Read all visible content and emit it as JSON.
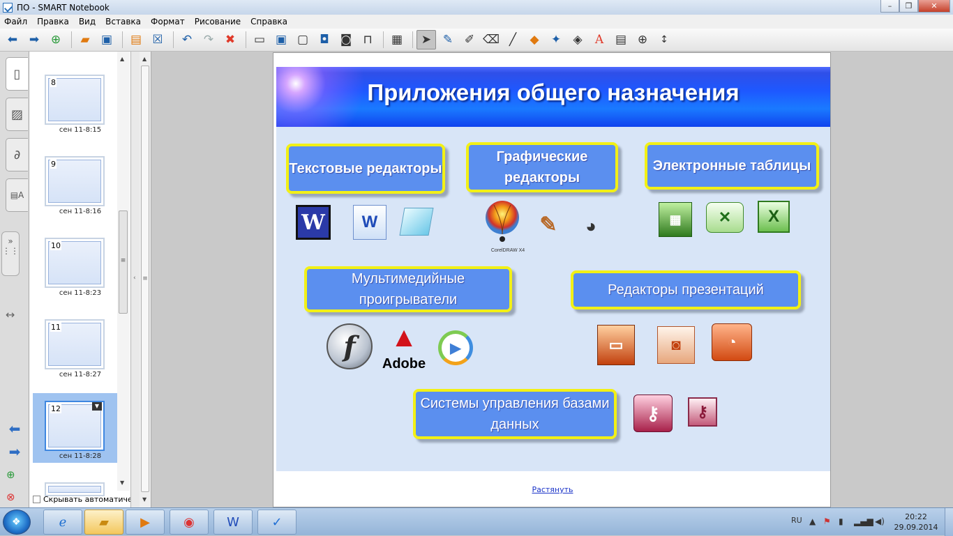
{
  "window": {
    "title": "ПО - SMART Notebook"
  },
  "menu": [
    "Файл",
    "Правка",
    "Вид",
    "Вставка",
    "Формат",
    "Рисование",
    "Справка"
  ],
  "toolbar": {
    "icons": [
      "back-arrow-icon",
      "forward-arrow-icon",
      "add-page-icon",
      "open-folder-icon",
      "save-icon",
      "paste-icon",
      "delete-page-icon",
      "undo-icon",
      "redo-icon",
      "delete-icon",
      "screen-shade-icon",
      "display-icon",
      "screen-capture-icon",
      "monitor-icon",
      "camera-icon",
      "toolbox-icon",
      "table-icon",
      "select-cursor-icon",
      "pen-icon",
      "creative-pen-icon",
      "eraser-icon",
      "line-icon",
      "shapes-icon",
      "magic-pen-icon",
      "fill-icon",
      "text-icon",
      "properties-icon",
      "measurement-icon",
      "move-toolbar-icon"
    ]
  },
  "sorter": {
    "pages": [
      {
        "num": "8",
        "time": "сен 11-8:15"
      },
      {
        "num": "9",
        "time": "сен 11-8:16"
      },
      {
        "num": "10",
        "time": "сен 11-8:23"
      },
      {
        "num": "11",
        "time": "сен 11-8:27"
      },
      {
        "num": "12",
        "time": "сен 11-8:28"
      }
    ],
    "autohide_label": "Скрывать автоматическ"
  },
  "slide": {
    "title": "Приложения общего назначения",
    "categories": {
      "text_editors": "Текстовые редакторы",
      "graphic_editors": "Графические редакторы",
      "spreadsheets": "Электронные таблицы",
      "media_players": "Мультимедийные проигрыватели",
      "presentations": "Редакторы презентаций",
      "databases": "Системы управления базами данных"
    },
    "logo_texts": {
      "adobe": "Adobe",
      "coreldraw": "CorelDRAW X4"
    }
  },
  "stretch_link": "Растянуть",
  "taskbar": {
    "lang": "RU",
    "time": "20:22",
    "date": "29.09.2014"
  },
  "colors": {
    "slide_header": "#1e58ff",
    "category_fill": "#5b8fef",
    "category_border": "#f2f016"
  }
}
